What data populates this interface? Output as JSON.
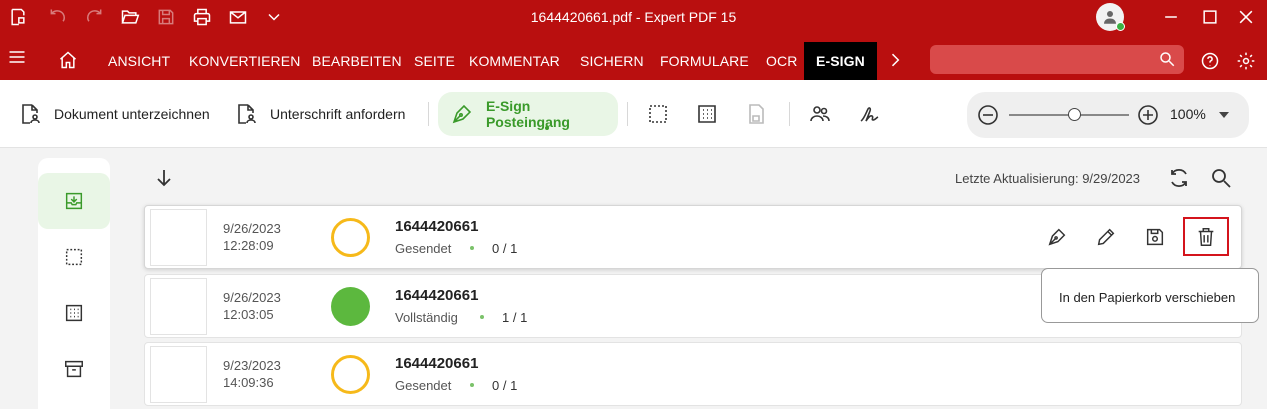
{
  "window": {
    "title": "1644420661.pdf  -  Expert PDF 15"
  },
  "menu": {
    "items": [
      "ANSICHT",
      "KONVERTIEREN",
      "BEARBEITEN",
      "SEITE",
      "KOMMENTAR",
      "SICHERN",
      "FORMULARE",
      "OCR",
      "E-SIGN"
    ],
    "active": "E-SIGN"
  },
  "toolbar": {
    "sign_doc": "Dokument unterzeichnen",
    "request_sig": "Unterschrift anfordern",
    "inbox": "E-Sign Posteingang",
    "zoom_value": "100%",
    "zoom_level": 0.55
  },
  "content": {
    "last_update": "Letzte Aktualisierung: 9/29/2023",
    "rows": [
      {
        "date": "9/26/2023",
        "time": "12:28:09",
        "name": "1644420661",
        "status": "Gesendet",
        "count": "0 / 1",
        "state": "pending"
      },
      {
        "date": "9/26/2023",
        "time": "12:03:05",
        "name": "1644420661",
        "status": "Vollständig",
        "count": "1 / 1",
        "state": "complete"
      },
      {
        "date": "9/23/2023",
        "time": "14:09:36",
        "name": "1644420661",
        "status": "Gesendet",
        "count": "0 / 1",
        "state": "pending"
      }
    ],
    "tooltip": "In den Papierkorb verschieben"
  },
  "colors": {
    "brand": "#b90f0f",
    "accent_green": "#3a9a2a",
    "pending": "#f6b91a",
    "complete": "#5cb83e",
    "highlight": "#d4141c"
  }
}
